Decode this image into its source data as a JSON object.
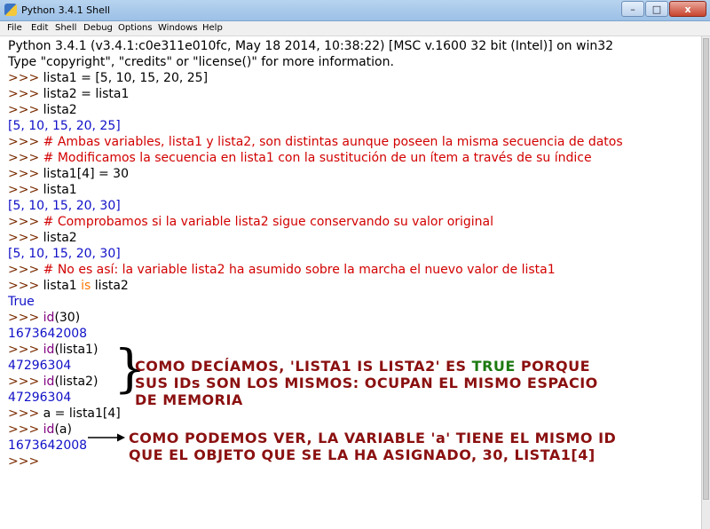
{
  "window": {
    "title": "Python 3.4.1 Shell",
    "min": "–",
    "max": "□",
    "close": "x"
  },
  "menu": [
    "File",
    "Edit",
    "Shell",
    "Debug",
    "Options",
    "Windows",
    "Help"
  ],
  "shell": {
    "banner1": "Python 3.4.1 (v3.4.1:c0e311e010fc, May 18 2014, 10:38:22) [MSC v.1600 32 bit (Intel)] on win32",
    "banner2": "Type \"copyright\", \"credits\" or \"license()\" for more information.",
    "prompt": ">>> ",
    "l3": "lista1 = [5, 10, 15, 20, 25]",
    "l4": "lista2 = lista1",
    "l5": "lista2",
    "o6": "[5, 10, 15, 20, 25]",
    "c7": "# Ambas variables, lista1 y lista2, son distintas aunque poseen la misma secuencia de datos",
    "c8": "# Modificamos la secuencia en lista1 con la sustitución de un ítem a través de su índice",
    "l9": "lista1[4] = 30",
    "l10": "lista1",
    "o11": "[5, 10, 15, 20, 30]",
    "c12": "# Comprobamos si la variable lista2 sigue conservando su valor original",
    "l13": "lista2",
    "o14": "[5, 10, 15, 20, 30]",
    "c15": "# No es así: la variable lista2 ha asumido sobre la marcha el nuevo valor de lista1",
    "l16a": "lista1 ",
    "l16kw": "is",
    "l16b": " lista2",
    "o17": "True",
    "id_fn": "id",
    "l18arg": "(30)",
    "o19": "1673642008",
    "l20arg": "(lista1)",
    "o21": "47296304",
    "l22arg": "(lista2)",
    "o23": "47296304",
    "l24": "a = lista1[4]",
    "l25arg": "(a)",
    "o26": "1673642008",
    "l27": ">>> "
  },
  "annotations": {
    "note1_a": "COMO DECÍAMOS, 'LISTA1 IS LISTA2' ES ",
    "note1_true": "TRUE",
    "note1_b": " PORQUE",
    "note1_line2": "SUS IDs SON LOS MISMOS: OCUPAN EL MISMO ESPACIO",
    "note1_line3": "DE MEMORIA",
    "note2_line1": "COMO PODEMOS VER, LA VARIABLE 'a' TIENE EL MISMO ID",
    "note2_line2": "QUE EL OBJETO QUE SE LA HA ASIGNADO, 30, LISTA1[4]",
    "brace": "}"
  },
  "colors": {
    "prompt": "#7a2b00",
    "output": "#1010c8",
    "comment": "#d20000",
    "builtin": "#800080",
    "keyword": "#ff7700",
    "annotation": "#8b1010",
    "true_highlight": "#1c7a10"
  }
}
